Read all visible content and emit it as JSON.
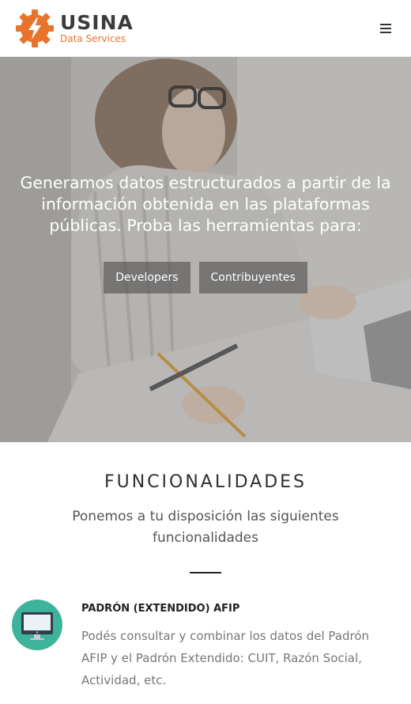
{
  "header": {
    "logo_name": "USINA",
    "logo_sub": "Data Services",
    "menu_icon": "hamburger-menu-icon"
  },
  "hero": {
    "text": "Generamos datos estructurados a partir de la información obtenida en las plataformas públicas. Proba las herramientas para:",
    "buttons": [
      "Developers",
      "Contribuyentes"
    ]
  },
  "features": {
    "title": "FUNCIONALIDADES",
    "subtitle": "Ponemos a tu disposición las siguientes funcionalidades",
    "items": [
      {
        "icon": "monitor-icon",
        "title": "PADRÓN (EXTENDIDO) AFIP",
        "description": "Podés consultar y combinar los datos del Padrón AFIP y el Padrón Extendido: CUIT, Razón Social, Actividad, etc."
      }
    ]
  },
  "colors": {
    "brand_orange": "#e8742c",
    "feature_green": "#3db39a",
    "logo_dark": "#3c3c3c"
  }
}
